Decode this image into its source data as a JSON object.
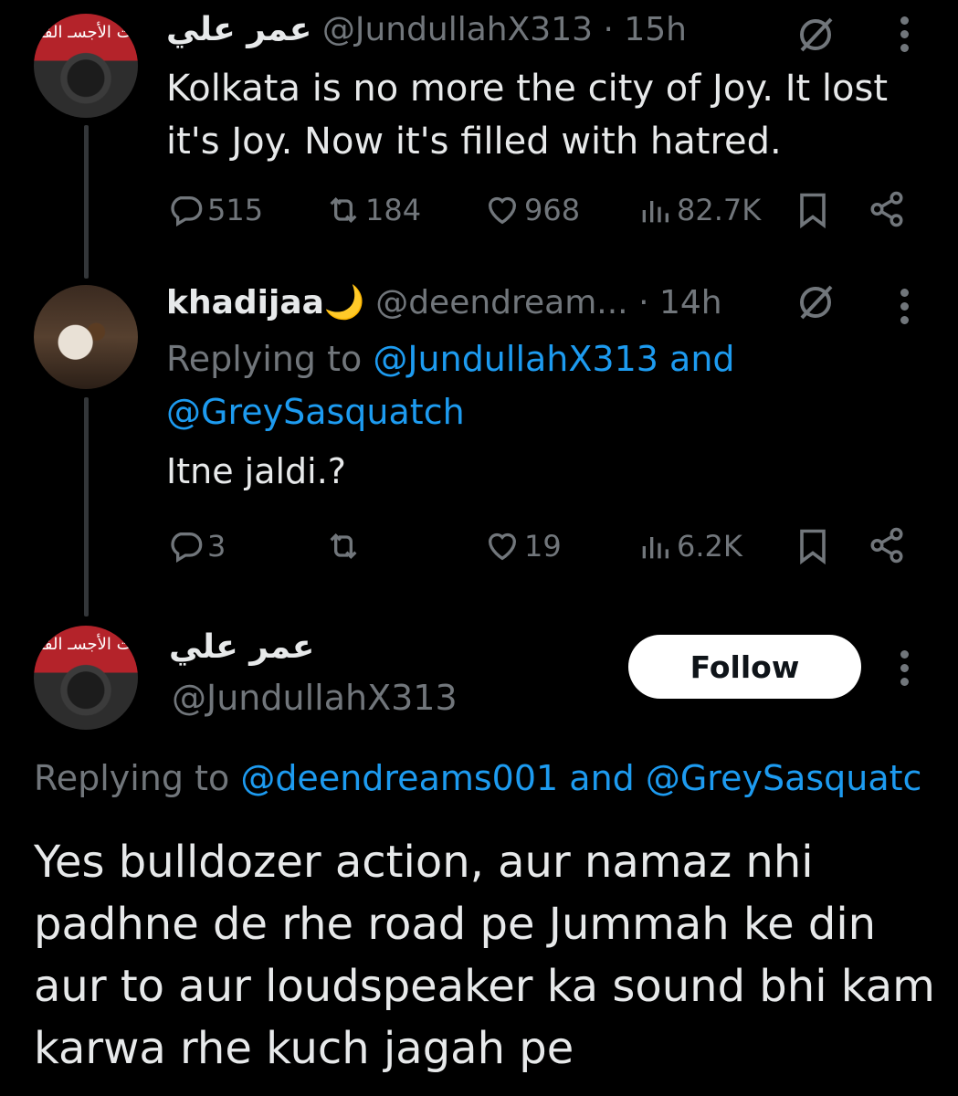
{
  "colors": {
    "background": "#000000",
    "text": "#e7e9ea",
    "muted": "#71767b",
    "link": "#1d9bf0",
    "thread_line": "#333639",
    "follow_bg": "#ffffff"
  },
  "tweet1": {
    "avatar_text": "ت الأجسـ الفا",
    "display_name": "عمر علي",
    "handle": "@JundullahX313",
    "time": "· 15h",
    "badge_icon": "grok-slash-icon",
    "text_line1": "Kolkata is no more the city of Joy. It lost",
    "text_line2": "it's Joy. Now it's filled with hatred.",
    "replies": "515",
    "reposts": "184",
    "likes": "968",
    "views": "82.7K"
  },
  "tweet2": {
    "display_name": "khadijaa",
    "name_emoji": "🌙",
    "handle": "@deendream...",
    "time": "· 14h",
    "badge_icon": "grok-slash-icon",
    "replying_prefix": "Replying to ",
    "replying_user1": "@JundullahX313",
    "replying_and": " and",
    "replying_user2": "@GreySasquatch",
    "text": "Itne jaldi.?",
    "replies": "3",
    "reposts": "",
    "likes": "19",
    "views": "6.2K"
  },
  "tweet3": {
    "avatar_text": "ت الأجسـ الفا",
    "display_name": "عمر علي",
    "handle": "@JundullahX313",
    "follow_label": "Follow",
    "replying_prefix": "Replying to ",
    "replying_user1": "@deendreams001",
    "replying_and": " and ",
    "replying_user2": "@GreySasquatc",
    "text_line1": "Yes bulldozer action, aur namaz nhi",
    "text_line2": "padhne de rhe road pe Jummah ke din",
    "text_line3": "aur to aur loudspeaker ka sound bhi kam",
    "text_line4": "karwa rhe kuch jagah pe"
  }
}
